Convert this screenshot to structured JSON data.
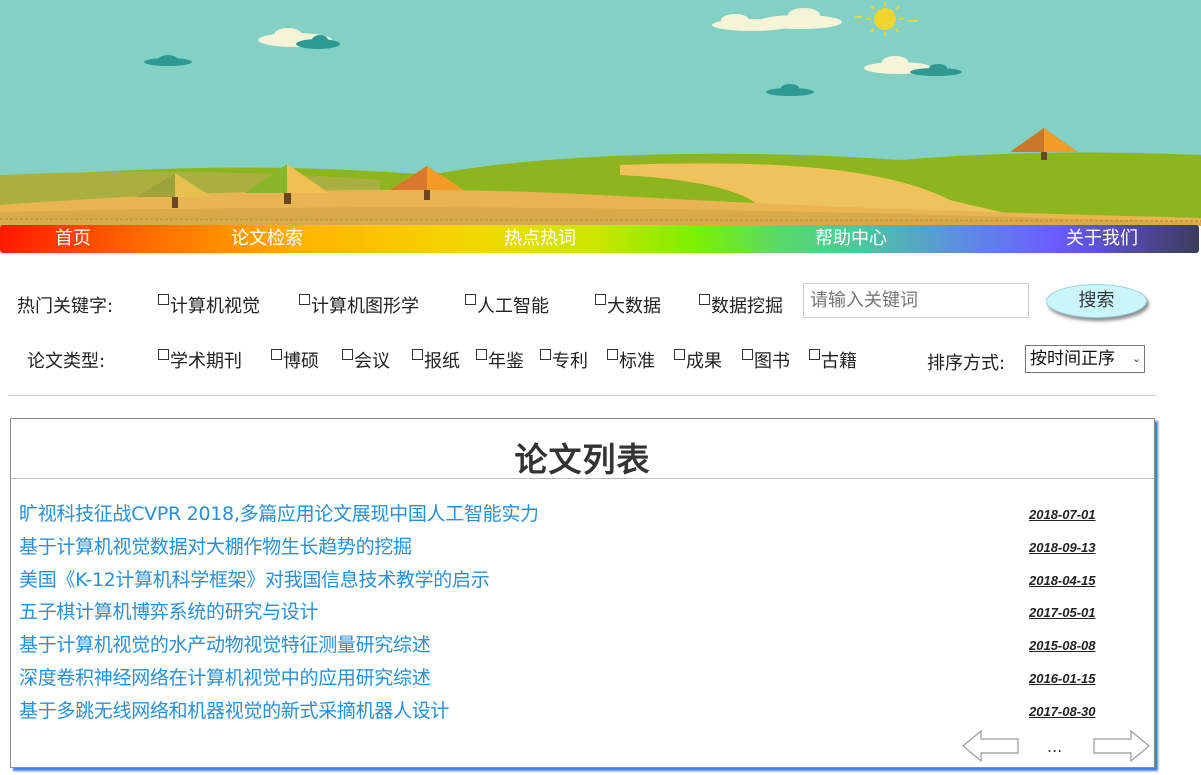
{
  "nav": {
    "items": [
      "首页",
      "论文检索",
      "热点热词",
      "帮助中心",
      "关于我们"
    ]
  },
  "filters": {
    "hot_keywords_label": "热门关键字:",
    "hot_keywords": [
      "计算机视觉",
      "计算机图形学",
      "人工智能",
      "大数据",
      "数据挖掘"
    ],
    "paper_type_label": "论文类型:",
    "paper_types": [
      "学术期刊",
      "博硕",
      "会议",
      "报纸",
      "年鉴",
      "专利",
      "标准",
      "成果",
      "图书",
      "古籍"
    ],
    "search_placeholder": "请输入关键词",
    "search_button": "搜索",
    "sort_label": "排序方式:",
    "sort_selected": "按时间正序"
  },
  "paper_list": {
    "title": "论文列表",
    "items": [
      {
        "title": "旷视科技征战CVPR 2018,多篇应用论文展现中国人工智能实力",
        "date": "2018-07-01"
      },
      {
        "title": "基于计算机视觉数据对大棚作物生长趋势的挖掘",
        "date": "2018-09-13"
      },
      {
        "title": "美国《K-12计算机科学框架》对我国信息技术教学的启示",
        "date": "2018-04-15"
      },
      {
        "title": "五子棋计算机博弈系统的研究与设计",
        "date": "2017-05-01"
      },
      {
        "title": "基于计算机视觉的水产动物视觉特征测量研究综述",
        "date": "2015-08-08"
      },
      {
        "title": "深度卷积神经网络在计算机视觉中的应用研究综述",
        "date": "2016-01-15"
      },
      {
        "title": "基于多跳无线网络和机器视觉的新式采摘机器人设计",
        "date": "2017-08-30"
      }
    ],
    "pager_ellipsis": "..."
  },
  "colors": {
    "sky": "#82d1c4",
    "link": "#2b8ed8",
    "search_button_bg": "#c9f5fb",
    "panel_shadow": "#3d7be6"
  }
}
